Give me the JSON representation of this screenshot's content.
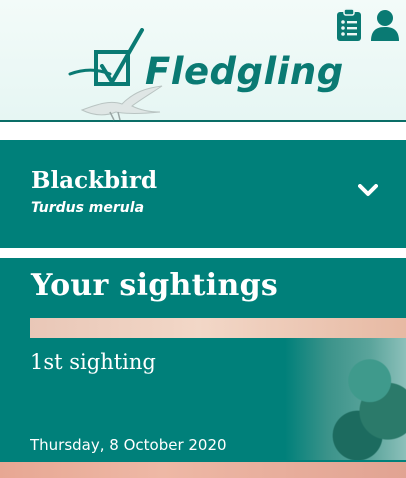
{
  "app": {
    "brand": "Fledgling"
  },
  "header": {
    "icons": [
      "clipboard-list-icon",
      "user-icon"
    ],
    "colors": {
      "accent": "#0a7a73",
      "background": "#eef8f6"
    }
  },
  "species": {
    "name": "Blackbird",
    "latin": "Turdus merula",
    "expand_icon": "chevron-down-icon"
  },
  "sightings": {
    "title": "Your sightings",
    "items": [
      {
        "label": "1st sighting",
        "date": "Thursday, 8 October 2020"
      }
    ]
  },
  "theme": {
    "panel": "#00807a",
    "text": "#ffffff"
  }
}
